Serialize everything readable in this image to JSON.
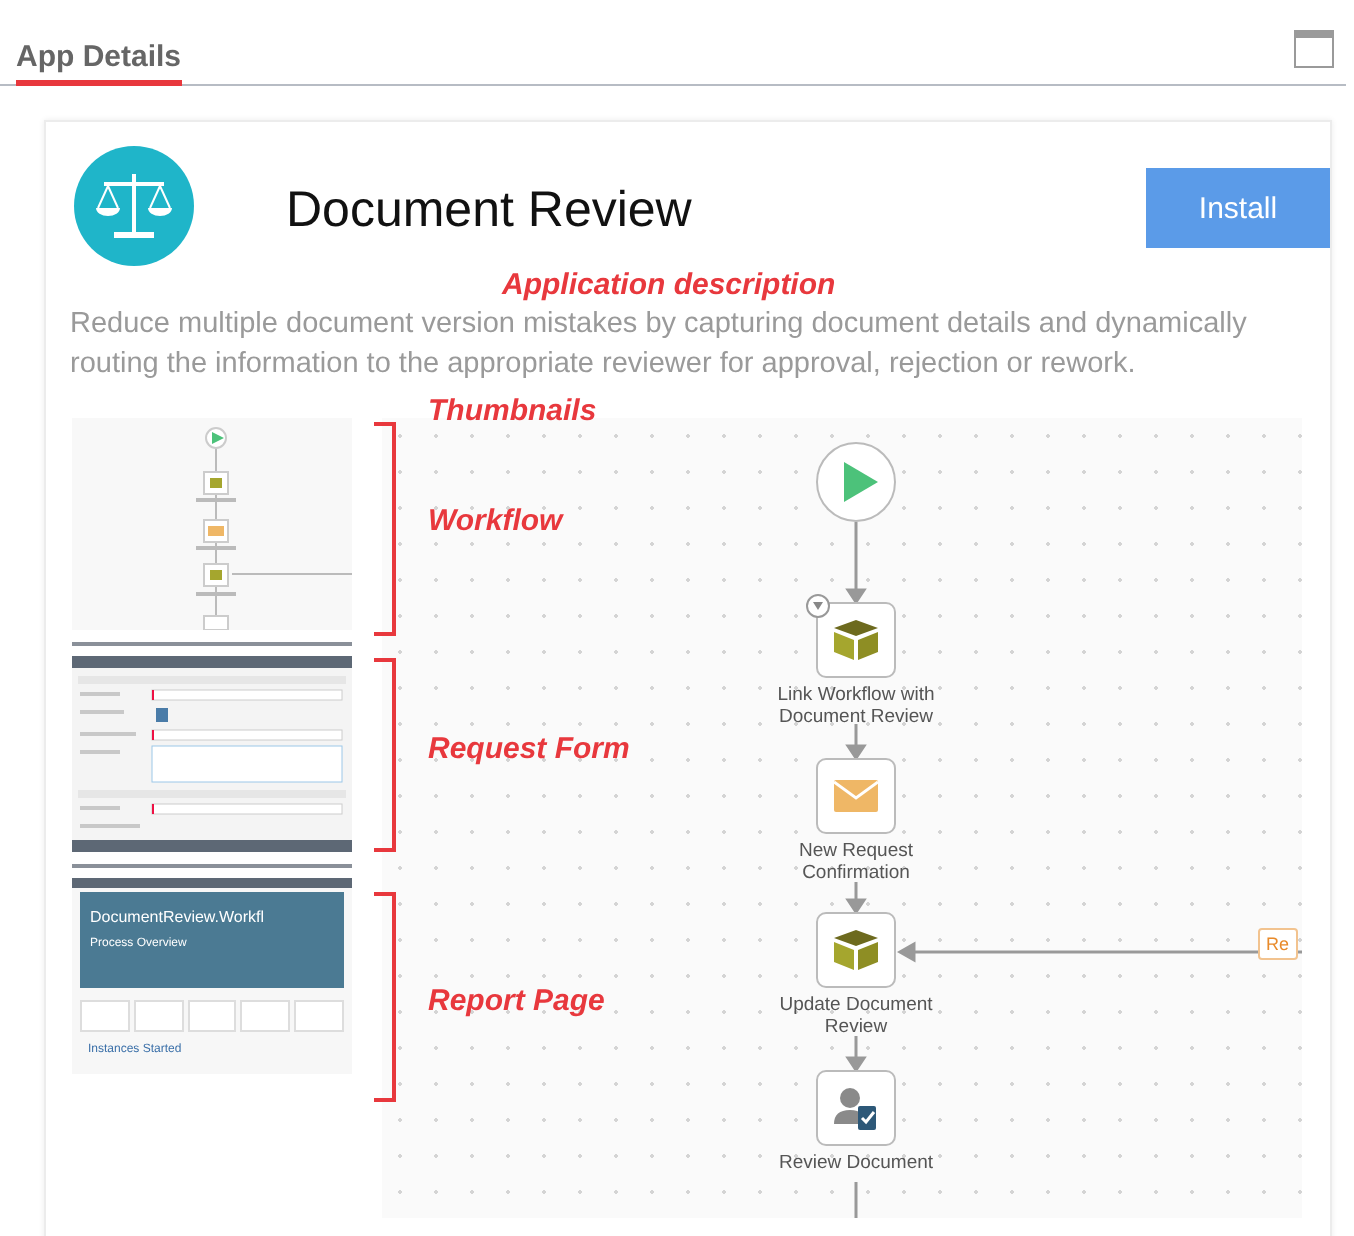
{
  "panel": {
    "title": "App Details"
  },
  "app": {
    "name": "Document Review",
    "install_button": "Install",
    "description": "Reduce multiple document version mistakes by capturing document details and dynamically routing the information to the appropriate reviewer for approval, rejection or rework."
  },
  "annotations": [
    {
      "kind": "description",
      "text": "Application description"
    },
    {
      "kind": "thumbnails",
      "text": "Thumbnails"
    },
    {
      "kind": "workflow",
      "text": "Workflow"
    },
    {
      "kind": "form",
      "text": "Request Form"
    },
    {
      "kind": "report",
      "text": "Report Page"
    }
  ],
  "thumbnails": [
    {
      "kind": "workflow"
    },
    {
      "kind": "form"
    },
    {
      "kind": "report",
      "title": "DocumentReview.Workfl",
      "subtitle": "Process Overview",
      "section": "Instances Started"
    }
  ],
  "workflow": {
    "nodes": [
      {
        "kind": "start"
      },
      {
        "kind": "task",
        "label": "Link Workflow with Document Review"
      },
      {
        "kind": "email",
        "label": "New Request Confirmation"
      },
      {
        "kind": "task",
        "label": "Update Document Review"
      },
      {
        "kind": "user",
        "label": "Review Document"
      }
    ],
    "side_tag": "Re"
  }
}
